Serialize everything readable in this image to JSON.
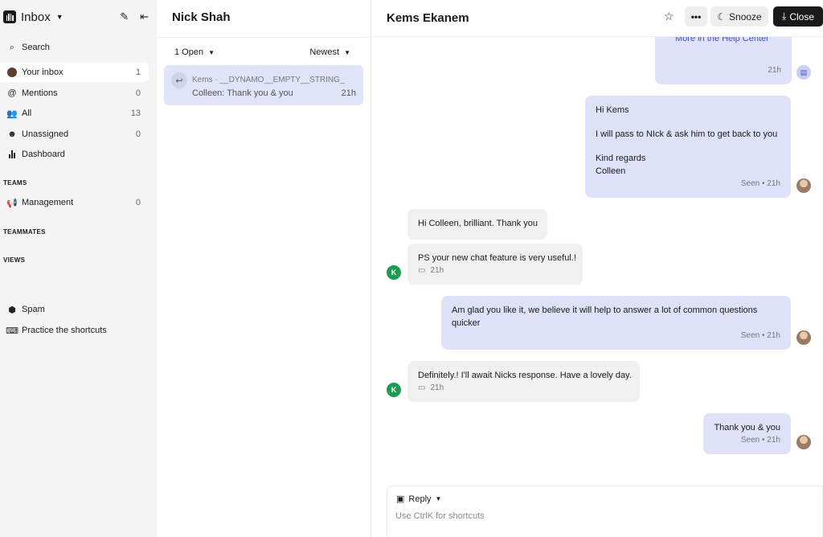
{
  "sidebar": {
    "title": "Inbox",
    "nav": [
      {
        "label": "Search",
        "count": ""
      },
      {
        "label": "Your inbox",
        "count": "1"
      },
      {
        "label": "Mentions",
        "count": "0"
      },
      {
        "label": "All",
        "count": "13"
      },
      {
        "label": "Unassigned",
        "count": "0"
      },
      {
        "label": "Dashboard",
        "count": ""
      }
    ],
    "teams_label": "TEAMS",
    "teams": [
      {
        "label": "Management",
        "count": "0"
      }
    ],
    "teammates_label": "TEAMMATES",
    "views_label": "VIEWS",
    "footer": [
      {
        "label": "Spam"
      },
      {
        "label": "Practice the shortcuts"
      }
    ]
  },
  "list": {
    "title": "Nick Shah",
    "status_filter": "1 Open",
    "sort_filter": "Newest",
    "conversation": {
      "line1": "Kems · __DYNAMO__EMPTY__STRING__",
      "line2": "Colleen: Thank you & you",
      "time": "21h"
    }
  },
  "chat": {
    "title": "Kems Ekanem",
    "snooze_label": "Snooze",
    "close_label": "Close",
    "messages": [
      {
        "text": "More in the Help Center",
        "meta": "21h"
      },
      {
        "lines": [
          "Hi Kems",
          "I will pass to NIck & ask him to get back to you",
          "Kind regards",
          "Colleen"
        ],
        "meta": "Seen • 21h"
      },
      {
        "text": "Hi Colleen, brilliant. Thank you"
      },
      {
        "text": "PS your new chat feature is very useful.!",
        "meta": "21h"
      },
      {
        "lines": [
          "Am glad you like it, we believe it will help to answer a lot of common questions",
          "quicker"
        ],
        "meta": "Seen • 21h"
      },
      {
        "text": "Definitely.! I'll await Nicks response. Have a lovely day.",
        "meta": "21h"
      },
      {
        "text": "Thank you & you",
        "meta": "Seen • 21h"
      }
    ],
    "avatar_initial": "K",
    "composer": {
      "mode": "Reply",
      "placeholder": "Use CtrlK for shortcuts"
    }
  }
}
